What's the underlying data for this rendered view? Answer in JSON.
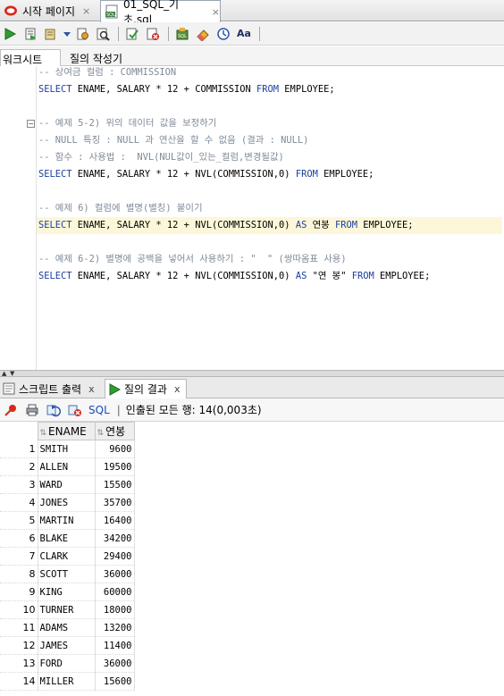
{
  "tabs": [
    {
      "label": "시작 페이지",
      "active": false
    },
    {
      "label": "01_SQL_기초.sql",
      "active": true
    }
  ],
  "tab_close": "×",
  "worksheet_tabs": [
    "워크시트",
    "질의 작성기"
  ],
  "toolbar": {
    "autotrace_label": "Aa"
  },
  "code_lines": [
    {
      "tokens": [
        {
          "c": "cm",
          "t": "-- 상여금 컬럼 : COMMISSION"
        }
      ]
    },
    {
      "tokens": [
        {
          "c": "kw",
          "t": "SELECT"
        },
        {
          "c": "txt",
          "t": " ENAME, SALARY * "
        },
        {
          "c": "num",
          "t": "12"
        },
        {
          "c": "txt",
          "t": " + COMMISSION "
        },
        {
          "c": "kw",
          "t": "FROM"
        },
        {
          "c": "txt",
          "t": " EMPLOYEE;"
        }
      ]
    },
    {
      "tokens": []
    },
    {
      "fold": true,
      "tokens": [
        {
          "c": "cm",
          "t": "-- 예제 5-2) 위의 데이터 값을 보정하기"
        }
      ]
    },
    {
      "tokens": [
        {
          "c": "cm",
          "t": "-- NULL 특징 : NULL 과 연산을 할 수 없음 (결과 : NULL)"
        }
      ]
    },
    {
      "tokens": [
        {
          "c": "cm",
          "t": "-- 함수 : 사용법 :  NVL(NUL값이_있는_컬럼,변경될값)"
        }
      ]
    },
    {
      "tokens": [
        {
          "c": "kw",
          "t": "SELECT"
        },
        {
          "c": "txt",
          "t": " ENAME, SALARY * "
        },
        {
          "c": "num",
          "t": "12"
        },
        {
          "c": "txt",
          "t": " + NVL(COMMISSION,"
        },
        {
          "c": "num",
          "t": "0"
        },
        {
          "c": "txt",
          "t": ") "
        },
        {
          "c": "kw",
          "t": "FROM"
        },
        {
          "c": "txt",
          "t": " EMPLOYEE;"
        }
      ]
    },
    {
      "tokens": []
    },
    {
      "tokens": [
        {
          "c": "cm",
          "t": "-- 예제 6) 컬럼에 별명(별칭) 붙이기"
        }
      ]
    },
    {
      "highlight": true,
      "tokens": [
        {
          "c": "kw",
          "t": "SELECT"
        },
        {
          "c": "txt",
          "t": " ENAME, SALARY * "
        },
        {
          "c": "num",
          "t": "12"
        },
        {
          "c": "txt",
          "t": " + NVL(COMMISSION,"
        },
        {
          "c": "num",
          "t": "0"
        },
        {
          "c": "txt",
          "t": ") "
        },
        {
          "c": "kw",
          "t": "AS"
        },
        {
          "c": "txt",
          "t": " 연봉 "
        },
        {
          "c": "kw",
          "t": "FROM"
        },
        {
          "c": "txt",
          "t": " EMPLOYEE;"
        }
      ]
    },
    {
      "tokens": []
    },
    {
      "tokens": [
        {
          "c": "cm",
          "t": "-- 예제 6-2) 별명에 공백을 넣어서 사용하기 : \"  \" (쌍따옴표 사용)"
        }
      ]
    },
    {
      "tokens": [
        {
          "c": "kw",
          "t": "SELECT"
        },
        {
          "c": "txt",
          "t": " ENAME, SALARY * "
        },
        {
          "c": "num",
          "t": "12"
        },
        {
          "c": "txt",
          "t": " + NVL(COMMISSION,"
        },
        {
          "c": "num",
          "t": "0"
        },
        {
          "c": "txt",
          "t": ") "
        },
        {
          "c": "kw",
          "t": "AS"
        },
        {
          "c": "txt",
          "t": " \"연 봉\" "
        },
        {
          "c": "kw",
          "t": "FROM"
        },
        {
          "c": "txt",
          "t": " EMPLOYEE;"
        }
      ]
    }
  ],
  "output_tabs": [
    {
      "label": "스크립트 출력",
      "active": false
    },
    {
      "label": "질의 결과",
      "active": true
    }
  ],
  "output_tab_close": "x",
  "results_toolbar": {
    "sql_label": "SQL",
    "separator": "|",
    "status": "인출된 모든 행: 14(0,003초)"
  },
  "grid": {
    "columns": [
      "ENAME",
      "연봉"
    ],
    "sort_glyph": "⇅",
    "rows": [
      {
        "n": "1",
        "ename": "SMITH",
        "salary": "9600"
      },
      {
        "n": "2",
        "ename": "ALLEN",
        "salary": "19500"
      },
      {
        "n": "3",
        "ename": "WARD",
        "salary": "15500"
      },
      {
        "n": "4",
        "ename": "JONES",
        "salary": "35700"
      },
      {
        "n": "5",
        "ename": "MARTIN",
        "salary": "16400"
      },
      {
        "n": "6",
        "ename": "BLAKE",
        "salary": "34200"
      },
      {
        "n": "7",
        "ename": "CLARK",
        "salary": "29400"
      },
      {
        "n": "8",
        "ename": "SCOTT",
        "salary": "36000"
      },
      {
        "n": "9",
        "ename": "KING",
        "salary": "60000"
      },
      {
        "n": "10",
        "ename": "TURNER",
        "salary": "18000"
      },
      {
        "n": "11",
        "ename": "ADAMS",
        "salary": "13200"
      },
      {
        "n": "12",
        "ename": "JAMES",
        "salary": "11400"
      },
      {
        "n": "13",
        "ename": "FORD",
        "salary": "36000"
      },
      {
        "n": "14",
        "ename": "MILLER",
        "salary": "15600"
      }
    ]
  },
  "colors": {
    "keyword": "#1a3ea0",
    "comment": "#7f8a98",
    "highlight_line": "#fdf7d9",
    "sql_link": "#1a4bb8"
  }
}
